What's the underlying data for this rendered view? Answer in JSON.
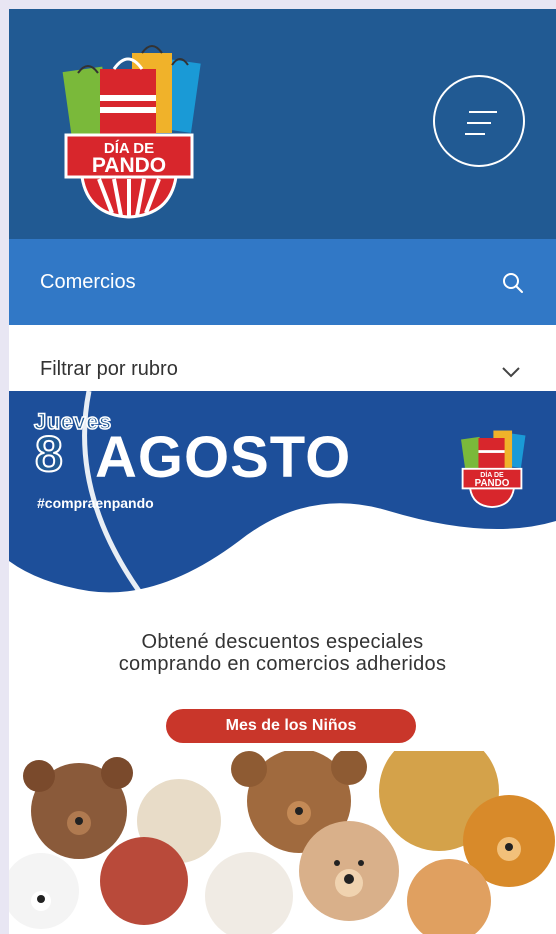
{
  "header": {
    "logo_text_line1": "DÍA DE",
    "logo_text_line2": "PANDO"
  },
  "nav": {
    "comercios_label": "Comercios"
  },
  "filter": {
    "label": "Filtrar por rubro"
  },
  "banner": {
    "day_name": "Jueves",
    "day_number": "8",
    "month": "AGOSTO",
    "hashtag": "#compraenpando",
    "promo_line1": "Obtené descuentos especiales",
    "promo_line2": "comprando en comercios adheridos",
    "pill_label": "Mes de los Niños"
  },
  "colors": {
    "header_bg": "#215a93",
    "nav_bg": "#3178c6",
    "pill_bg": "#c9362a"
  },
  "icons": [
    "menu-icon",
    "search-icon",
    "chevron-down-icon"
  ]
}
